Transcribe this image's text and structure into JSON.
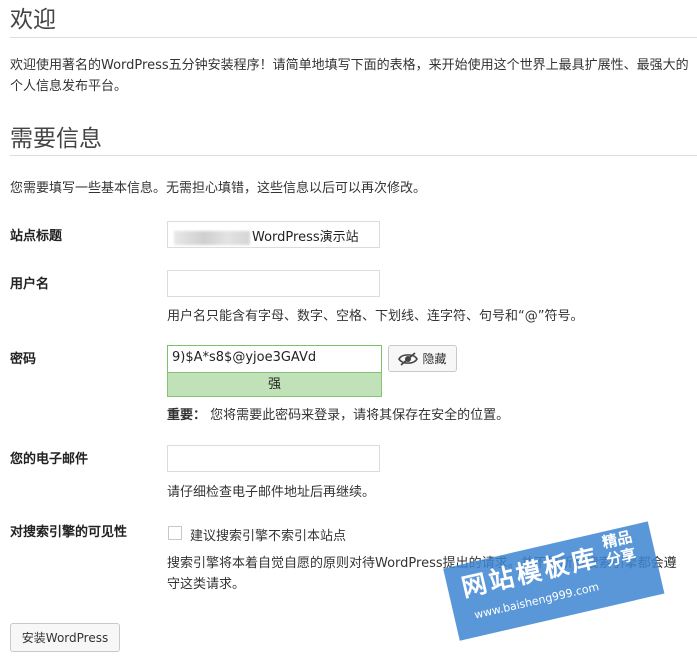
{
  "welcome": {
    "title": "欢迎",
    "intro": "欢迎使用著名的WordPress五分钟安装程序！请简单地填写下面的表格，来开始使用这个世界上最具扩展性、最强大的个人信息发布平台。"
  },
  "info": {
    "title": "需要信息",
    "note": "您需要填写一些基本信息。无需担心填错，这些信息以后可以再次修改。"
  },
  "form": {
    "site_title": {
      "label": "站点标题",
      "value": "WordPress演示站"
    },
    "username": {
      "label": "用户名",
      "value": "",
      "help": "用户名只能含有字母、数字、空格、下划线、连字符、句号和“@”符号。"
    },
    "password": {
      "label": "密码",
      "value": "9)$A*s8$@yjoe3GAVd",
      "strength": "强",
      "hide_label": "隐藏",
      "important_label": "重要：",
      "important_text": "您将需要此密码来登录，请将其保存在安全的位置。"
    },
    "email": {
      "label": "您的电子邮件",
      "value": "",
      "help": "请仔细检查电子邮件地址后再继续。"
    },
    "search_visibility": {
      "label": "对搜索引擎的可见性",
      "checkbox_label": "建议搜索引擎不索引本站点",
      "checked": false,
      "description": "搜索引擎将本着自觉自愿的原则对待WordPress提出的请求。并不是所有搜索引擎都会遵守这类请求。"
    },
    "install_button": "安装WordPress"
  },
  "watermark": {
    "name": "网站模板库",
    "url": "www.baisheng999.com",
    "tag": "精品分享"
  },
  "colors": {
    "strength_bg": "#c1e1b9",
    "strength_border": "#83c373",
    "watermark_blue": "#3d85d1"
  }
}
